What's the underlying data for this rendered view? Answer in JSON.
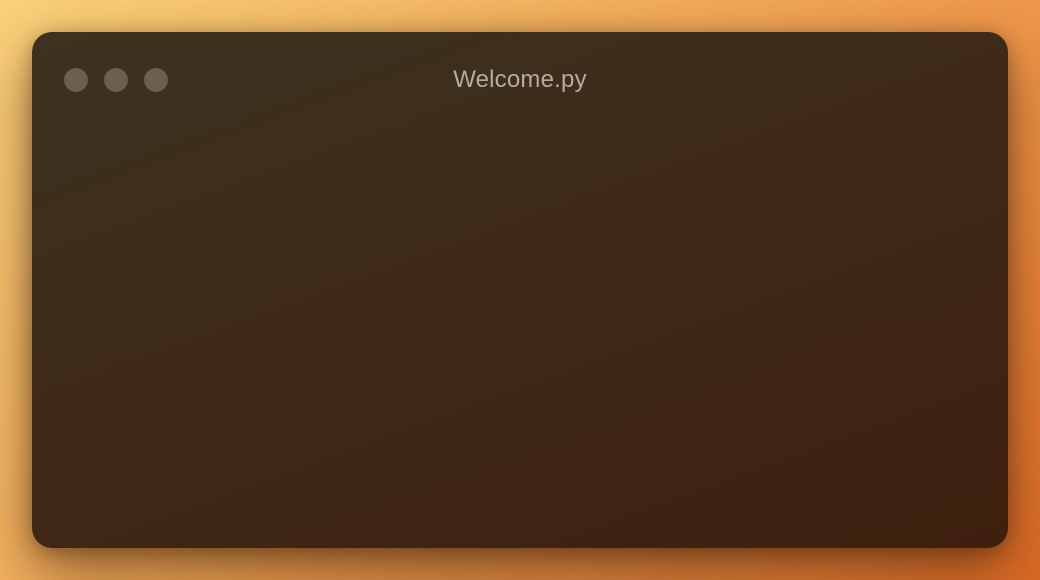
{
  "window": {
    "title": "Welcome.py",
    "controls": [
      {
        "name": "close",
        "color": "#6a5f50"
      },
      {
        "name": "minimize",
        "color": "#6a5f50"
      },
      {
        "name": "zoom",
        "color": "#6a5f50"
      }
    ],
    "background_colors": [
      "#3c3220",
      "#3f200f"
    ]
  },
  "desktop": {
    "background_colors": [
      "#fbd27c",
      "#dd6a26"
    ]
  }
}
